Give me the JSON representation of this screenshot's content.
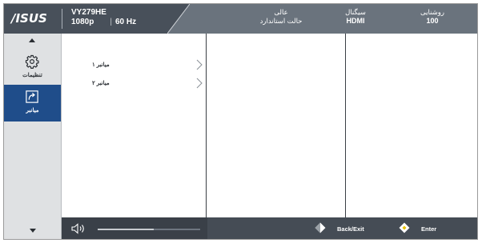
{
  "brand": {
    "logo_text": "/ISUS"
  },
  "header": {
    "model": "VY279HE",
    "resolution": "1080p",
    "separator": "|",
    "refresh": "60 Hz",
    "status": [
      {
        "label": "عالی",
        "value": "حالت استاندارد"
      },
      {
        "label": "سیگنال",
        "value": "HDMI"
      },
      {
        "label": "روشنایی",
        "value": "100"
      }
    ]
  },
  "sidebar": {
    "items": [
      {
        "label": "تنظیمات",
        "icon": "gear-icon",
        "selected": false
      },
      {
        "label": "میانبر",
        "icon": "shortcut-arrow-icon",
        "selected": true
      }
    ]
  },
  "menu": {
    "rows": [
      {
        "label": "میانبر ۱"
      },
      {
        "label": "میانبر ۲"
      }
    ]
  },
  "footer": {
    "volume_level": 0.55,
    "back_label": "Back/Exit",
    "enter_label": "Enter"
  },
  "colors": {
    "header_dark": "#48505a",
    "header_light": "#6a737d",
    "sidebar_bg": "#dfe1e3",
    "selected_bg": "#1f4d8a",
    "footer_bg": "#454c55",
    "key_yellow": "#e8c200"
  }
}
